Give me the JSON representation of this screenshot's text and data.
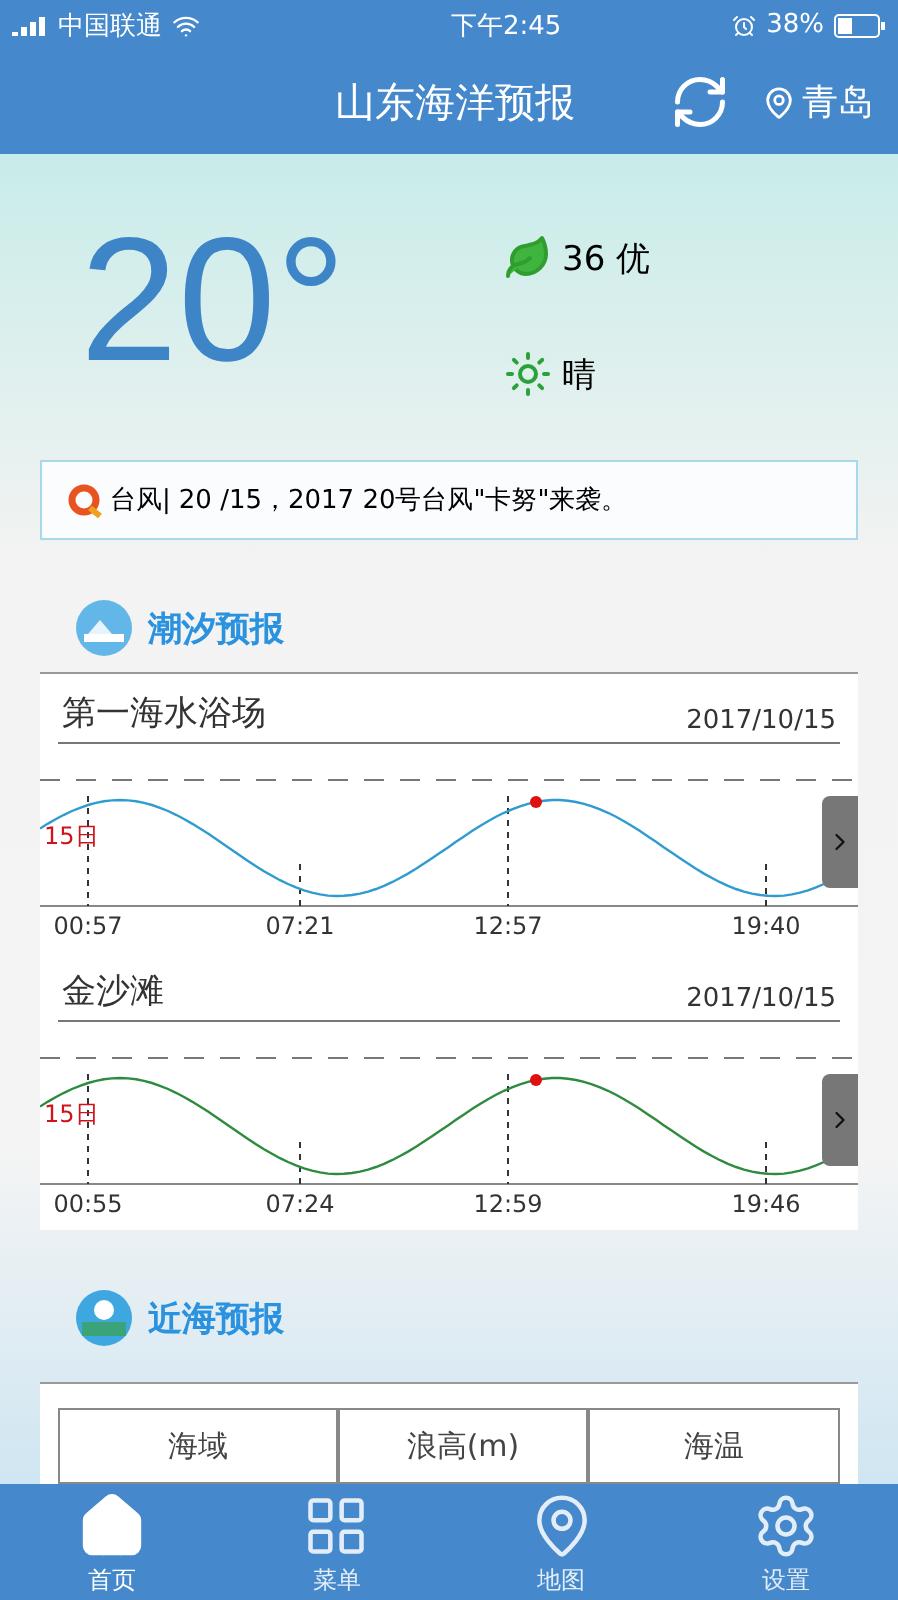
{
  "status_bar": {
    "carrier": "中国联通",
    "time": "下午2:45",
    "battery": "38%"
  },
  "header": {
    "title": "山东海洋预报",
    "city": "青岛"
  },
  "weather": {
    "temperature": "20°",
    "aqi": "36 优",
    "condition": "晴"
  },
  "notice": {
    "tag": "台风|",
    "text": "20  /15，2017 20号台风\"卡努\"来袭。"
  },
  "tide": {
    "title": "潮汐预报",
    "stations": [
      {
        "name": "第一海水浴场",
        "date": "2017/10/15",
        "day_label": "15日",
        "times": [
          "00:57",
          "07:21",
          "12:57",
          "19:40"
        ],
        "color": "#2f9bd0"
      },
      {
        "name": "金沙滩",
        "date": "2017/10/15",
        "day_label": "15日",
        "times": [
          "00:55",
          "07:24",
          "12:59",
          "19:46"
        ],
        "color": "#2e8b3e"
      }
    ]
  },
  "nearshore": {
    "title": "近海预报",
    "columns": [
      "海域",
      "浪高(m)",
      "海温"
    ]
  },
  "tab_bar": [
    {
      "label": "首页",
      "selected": true
    },
    {
      "label": "菜单",
      "selected": false
    },
    {
      "label": "地图",
      "selected": false
    },
    {
      "label": "设置",
      "selected": false
    }
  ]
}
